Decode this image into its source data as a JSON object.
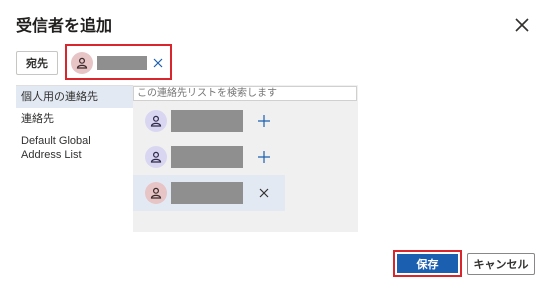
{
  "dialog": {
    "title": "受信者を追加",
    "close_icon": "close-icon"
  },
  "to_button": {
    "label": "宛先"
  },
  "selected_chip": {
    "avatar_icon": "person-icon",
    "remove_icon": "close-icon"
  },
  "sidebar": {
    "items": [
      {
        "label": "個人用の連絡先",
        "selected": true
      },
      {
        "label": "連絡先",
        "selected": false
      },
      {
        "label": "Default Global Address List",
        "selected": false
      }
    ]
  },
  "search": {
    "placeholder": "この連絡先リストを検索します"
  },
  "contacts": [
    {
      "action_icon": "plus-icon",
      "avatar_color": "#d9d6f2",
      "selected": false
    },
    {
      "action_icon": "plus-icon",
      "avatar_color": "#d9d6f2",
      "selected": false
    },
    {
      "action_icon": "close-icon",
      "avatar_color": "#e7c4c6",
      "selected": true
    }
  ],
  "footer": {
    "save_label": "保存",
    "cancel_label": "キャンセル"
  },
  "colors": {
    "primary": "#1b5fb0",
    "highlight_border": "#d9262c",
    "selection": "#e3e9f3"
  }
}
